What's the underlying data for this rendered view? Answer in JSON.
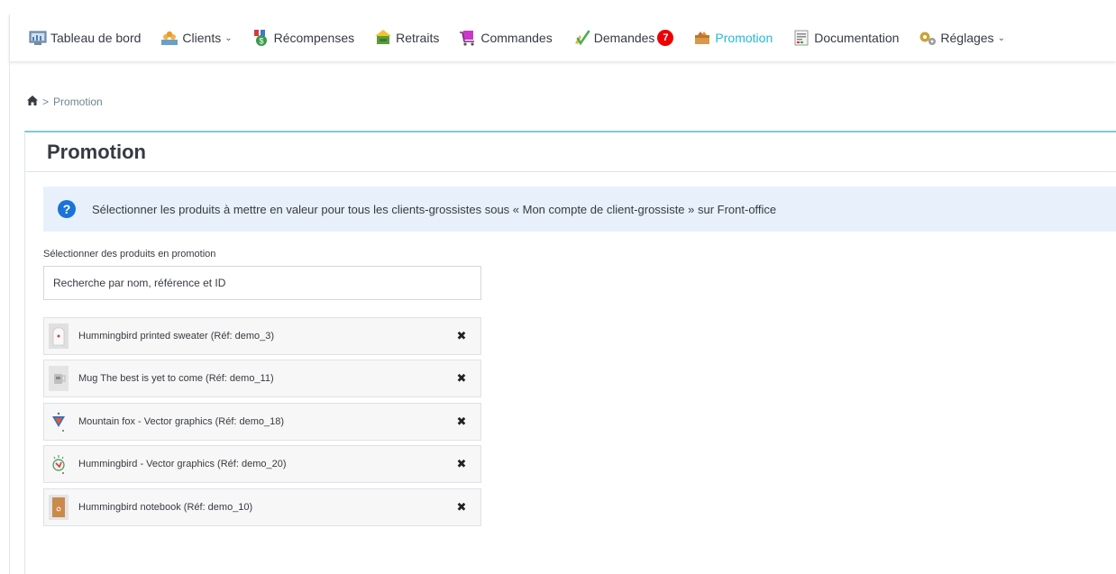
{
  "nav": {
    "items": [
      {
        "label": "Tableau de bord",
        "icon": "dashboard-icon"
      },
      {
        "label": "Clients",
        "icon": "clients-icon",
        "dropdown": true
      },
      {
        "label": "Récompenses",
        "icon": "rewards-icon"
      },
      {
        "label": "Retraits",
        "icon": "withdrawals-icon"
      },
      {
        "label": "Commandes",
        "icon": "orders-icon"
      },
      {
        "label": "Demandes",
        "icon": "requests-icon",
        "badge": "7"
      },
      {
        "label": "Promotion",
        "icon": "promotion-icon",
        "active": true
      },
      {
        "label": "Documentation",
        "icon": "documentation-icon"
      },
      {
        "label": "Réglages",
        "icon": "settings-icon",
        "dropdown": true
      }
    ],
    "active_color": "#25b9d7",
    "badge_color": "#ee0000"
  },
  "breadcrumb": {
    "separator": ">",
    "current": "Promotion"
  },
  "panel": {
    "title": "Promotion"
  },
  "alert": {
    "text": "Sélectionner les produits à mettre en valeur pour tous les clients-grossistes sous « Mon compte de client-grossiste » sur Front-office",
    "icon": "help-icon"
  },
  "form": {
    "label": "Sélectionner des produits en promotion",
    "search_placeholder": "Recherche par nom, référence et ID"
  },
  "products": [
    {
      "label": "Hummingbird printed sweater (Réf: demo_3)"
    },
    {
      "label": "Mug The best is yet to come (Réf: demo_11)"
    },
    {
      "label": "Mountain fox - Vector graphics (Réf: demo_18)"
    },
    {
      "label": "Hummingbird - Vector graphics (Réf: demo_20)"
    },
    {
      "label": "Hummingbird notebook (Réf: demo_10)"
    }
  ]
}
